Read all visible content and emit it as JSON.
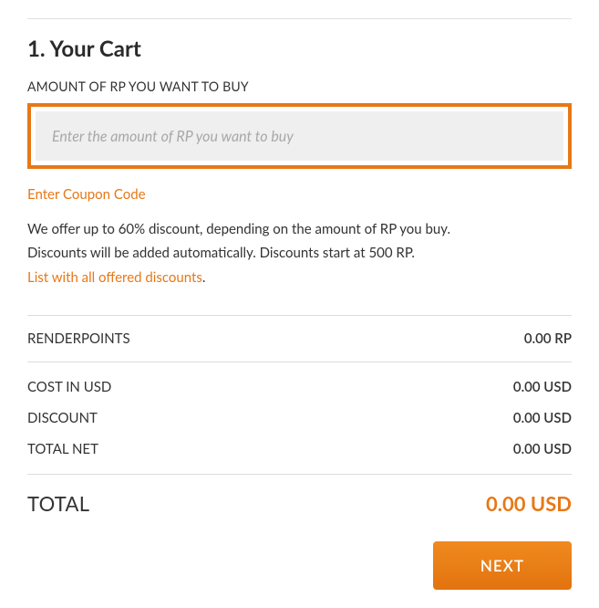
{
  "cart": {
    "title": "1. Your Cart",
    "field_label": "AMOUNT OF RP YOU WANT TO BUY",
    "placeholder": "Enter the amount of RP you want to buy",
    "coupon_link": "Enter Coupon Code",
    "info_line1": "We offer up to 60% discount, depending on the amount of RP you buy.",
    "info_line2": "Discounts will be added automatically. Discounts start at 500 RP.",
    "discounts_link": "List with all offered discounts",
    "period": "."
  },
  "summary": {
    "renderpoints_label": "RENDERPOINTS",
    "renderpoints_value": "0.00 RP",
    "cost_label": "COST IN USD",
    "cost_value": "0.00 USD",
    "discount_label": "DISCOUNT",
    "discount_value": "0.00 USD",
    "totalnet_label": "TOTAL NET",
    "totalnet_value": "0.00 USD",
    "total_label": "TOTAL",
    "total_value": "0.00 USD"
  },
  "actions": {
    "next": "NEXT"
  }
}
